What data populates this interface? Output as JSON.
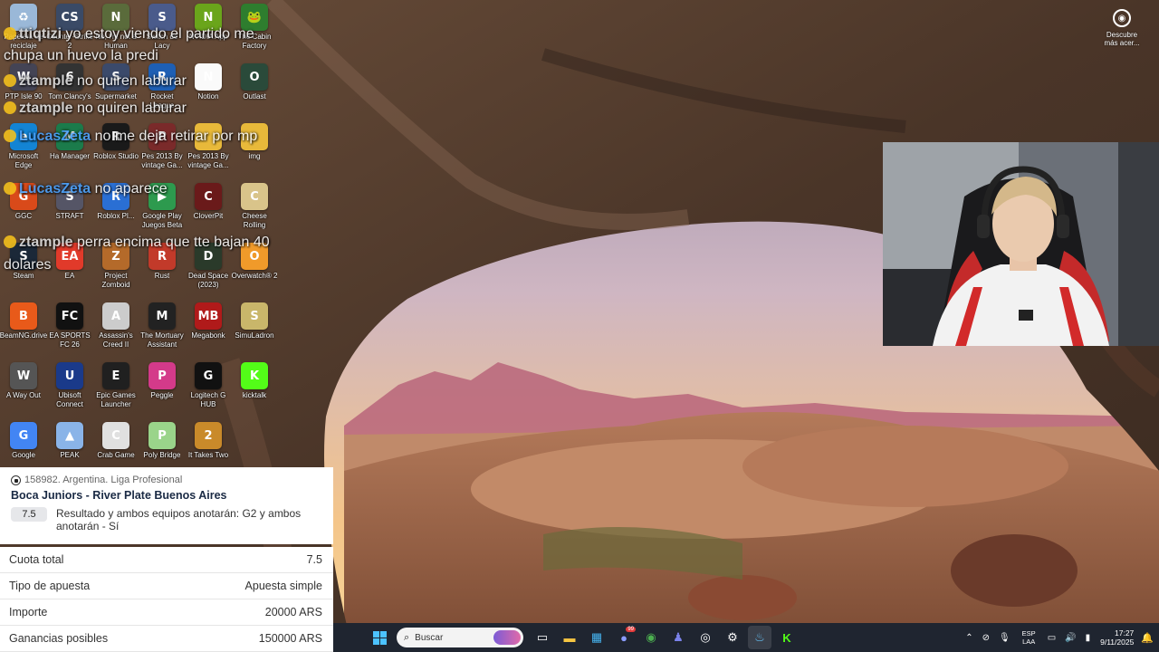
{
  "desktop": {
    "icons": [
      {
        "label": "Papelera de reciclaje",
        "icon": "recycle-bin-icon",
        "color": "#9ab8d8",
        "glyph": "♻"
      },
      {
        "label": "Counter-Strike 2",
        "icon": "counter-strike-icon",
        "color": "#3a4a66",
        "glyph": "CS"
      },
      {
        "label": "No, I'm not a Human",
        "icon": "no-im-not-human-icon",
        "color": "#5a6b3b",
        "glyph": "N"
      },
      {
        "label": "Switch de Lacy",
        "icon": "switch-icon",
        "color": "#4a5b8b",
        "glyph": "S"
      },
      {
        "label": "NVIDIA App",
        "icon": "nvidia-icon",
        "color": "#6aa51b",
        "glyph": "N"
      },
      {
        "label": "The Cabin Factory",
        "icon": "cabin-factory-icon",
        "color": "#2e7d2e",
        "glyph": "🐸"
      },
      {
        "label": "PTP Isle 90",
        "icon": "ptp-icon",
        "color": "#445",
        "glyph": "W"
      },
      {
        "label": "Tom Clancy's",
        "icon": "rainbow-six-icon",
        "color": "#333",
        "glyph": "6"
      },
      {
        "label": "Supermarket",
        "icon": "supermarket-icon",
        "color": "#3b4a6b",
        "glyph": "S"
      },
      {
        "label": "Rocket League",
        "icon": "rocket-league-icon",
        "color": "#1e5fb4",
        "glyph": "R"
      },
      {
        "label": "Notion",
        "icon": "notion-icon",
        "color": "#fafafa",
        "glyph": "N"
      },
      {
        "label": "Outlast",
        "icon": "outlast-icon",
        "color": "#2a4a3a",
        "glyph": "O"
      },
      {
        "label": "Microsoft Edge",
        "icon": "edge-icon",
        "color": "#1384d4",
        "glyph": "e"
      },
      {
        "label": "Ha Manager",
        "icon": "manager-icon",
        "color": "#1b7b4b",
        "glyph": "M"
      },
      {
        "label": "Roblox Studio",
        "icon": "roblox-studio-icon",
        "color": "#1a1a1a",
        "glyph": "R"
      },
      {
        "label": "Pes 2013 By vintage Ga...",
        "icon": "pes-icon",
        "color": "#7a2a2a",
        "glyph": "P"
      },
      {
        "label": "Pes 2013 By vintage Ga...",
        "icon": "folder-icon",
        "color": "#e8b93a",
        "glyph": ""
      },
      {
        "label": "img",
        "icon": "folder-icon",
        "color": "#e8b93a",
        "glyph": ""
      },
      {
        "label": "GGC",
        "icon": "ggc-icon",
        "color": "#d94a1a",
        "glyph": "G"
      },
      {
        "label": "STRAFT",
        "icon": "straft-icon",
        "color": "#556",
        "glyph": "S"
      },
      {
        "label": "Roblox Pl...",
        "icon": "roblox-player-icon",
        "color": "#2a6fd4",
        "glyph": "R"
      },
      {
        "label": "Google Play Juegos Beta",
        "icon": "google-play-games-icon",
        "color": "#2d9a4e",
        "glyph": "▶"
      },
      {
        "label": "CloverPit",
        "icon": "cloverpit-icon",
        "color": "#6a1a1a",
        "glyph": "C"
      },
      {
        "label": "Cheese Rolling",
        "icon": "cheese-rolling-icon",
        "color": "#d9c48a",
        "glyph": "C"
      },
      {
        "label": "Steam",
        "icon": "steam-icon",
        "color": "#1b2838",
        "glyph": "S"
      },
      {
        "label": "EA",
        "icon": "ea-icon",
        "color": "#e13a2a",
        "glyph": "EA"
      },
      {
        "label": "Project Zomboid",
        "icon": "project-zomboid-icon",
        "color": "#b46a2a",
        "glyph": "Z"
      },
      {
        "label": "Rust",
        "icon": "rust-icon",
        "color": "#c23a2a",
        "glyph": "R"
      },
      {
        "label": "Dead Space (2023)",
        "icon": "dead-space-icon",
        "color": "#2a3a2a",
        "glyph": "D"
      },
      {
        "label": "Overwatch® 2",
        "icon": "overwatch-icon",
        "color": "#f09a2a",
        "glyph": "O"
      },
      {
        "label": "BeamNG.drive",
        "icon": "beamng-icon",
        "color": "#e85a1a",
        "glyph": "B"
      },
      {
        "label": "EA SPORTS FC 26",
        "icon": "ea-fc-icon",
        "color": "#111",
        "glyph": "FC"
      },
      {
        "label": "Assassin's Creed II",
        "icon": "assassins-creed-icon",
        "color": "#ccc",
        "glyph": "A"
      },
      {
        "label": "The Mortuary Assistant",
        "icon": "mortuary-assistant-icon",
        "color": "#222",
        "glyph": "M"
      },
      {
        "label": "Megabonk",
        "icon": "megabonk-icon",
        "color": "#b01a1a",
        "glyph": "MB"
      },
      {
        "label": "SimuLadron",
        "icon": "simuladron-icon",
        "color": "#c9b66a",
        "glyph": "S"
      },
      {
        "label": "A Way Out",
        "icon": "a-way-out-icon",
        "color": "#555",
        "glyph": "W"
      },
      {
        "label": "Ubisoft Connect",
        "icon": "ubisoft-icon",
        "color": "#1a3a8a",
        "glyph": "U"
      },
      {
        "label": "Epic Games Launcher",
        "icon": "epic-games-icon",
        "color": "#202020",
        "glyph": "E"
      },
      {
        "label": "Peggle",
        "icon": "peggle-icon",
        "color": "#d43a8a",
        "glyph": "P"
      },
      {
        "label": "Logitech G HUB",
        "icon": "logitech-icon",
        "color": "#111",
        "glyph": "G"
      },
      {
        "label": "kicktalk",
        "icon": "kicktalk-icon",
        "color": "#53fc18",
        "glyph": "K"
      },
      {
        "label": "Google",
        "icon": "chrome-icon",
        "color": "#4285f4",
        "glyph": "G"
      },
      {
        "label": "PEAK",
        "icon": "peak-icon",
        "color": "#8ab4e8",
        "glyph": "▲"
      },
      {
        "label": "Crab Game",
        "icon": "crab-game-icon",
        "color": "#e0e0e0",
        "glyph": "C"
      },
      {
        "label": "Poly Bridge",
        "icon": "poly-bridge-icon",
        "color": "#9ad48a",
        "glyph": "P"
      },
      {
        "label": "It Takes Two",
        "icon": "it-takes-two-icon",
        "color": "#c98a2a",
        "glyph": "2"
      }
    ]
  },
  "chat": [
    {
      "user": "ttiqtizi",
      "blue": false,
      "text": " yo estoy viendo el partido me"
    },
    {
      "user": "",
      "blue": false,
      "text": "chupa un huevo la predi"
    },
    {
      "user": "ztample",
      "blue": false,
      "text": " no quiren laburar"
    },
    {
      "user": "ztample",
      "blue": false,
      "text": " no quiren laburar"
    },
    {
      "user": "LucasZeta",
      "blue": true,
      "text": " no me deja retirar por mp"
    },
    {
      "user": "LucasZeta",
      "blue": true,
      "text": " no aparece"
    },
    {
      "user": "ztample",
      "blue": false,
      "text": " perra encima que tte bajan 40"
    },
    {
      "user": "",
      "blue": false,
      "text": "dolares"
    }
  ],
  "discover": {
    "line1": "Descubre",
    "line2": "más acer..."
  },
  "bet": {
    "event_id": "158982. Argentina. Liga Profesional",
    "match": "Boca Juniors - River Plate Buenos Aires",
    "odds": "7.5",
    "selection": "Resultado y ambos equipos anotarán: G2 y ambos anotarán - Sí",
    "summary": [
      {
        "label": "Cuota total",
        "value": "7.5"
      },
      {
        "label": "Tipo de apuesta",
        "value": "Apuesta simple"
      },
      {
        "label": "Importe",
        "value": "20000 ARS"
      },
      {
        "label": "Ganancias posibles",
        "value": "150000 ARS"
      }
    ]
  },
  "taskbar": {
    "search_placeholder": "Buscar",
    "apps": [
      "task-view-icon",
      "file-explorer-icon",
      "microsoft-store-icon",
      "discord-icon",
      "chrome-icon",
      "teams-icon",
      "obs-icon",
      "settings-icon",
      "steam-icon",
      "kick-icon"
    ],
    "discord_badge": "99",
    "lang_line1": "ESP",
    "lang_line2": "LAA",
    "time": "17:27",
    "date": "9/11/2025"
  },
  "colors": {
    "accent": "#4cc2ff",
    "taskbar": "#1f2530",
    "kick_green": "#53fc18"
  }
}
